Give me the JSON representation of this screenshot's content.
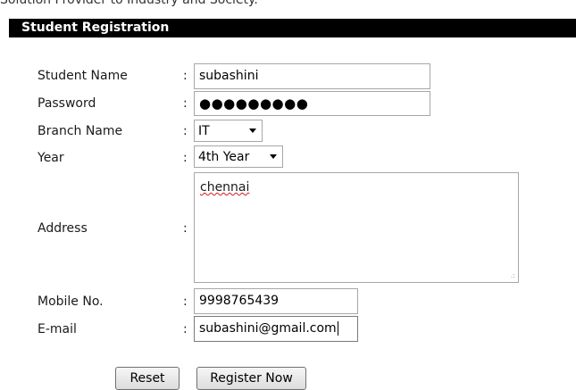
{
  "top_clipped_text": "Solution Provider to Industry and Society.",
  "header": {
    "title": "Student Registration"
  },
  "form": {
    "colon": ":",
    "student_name": {
      "label": "Student Name",
      "value": "subashini"
    },
    "password": {
      "label": "Password",
      "value": "●●●●●●●●●"
    },
    "branch": {
      "label": "Branch Name",
      "selected": "IT"
    },
    "year": {
      "label": "Year",
      "selected": "4th Year"
    },
    "address": {
      "label": "Address",
      "value": "chennai"
    },
    "mobile": {
      "label": "Mobile No.",
      "value": "9998765439"
    },
    "email": {
      "label": "E-mail",
      "value": "subashini@gmail.com"
    }
  },
  "buttons": {
    "reset": "Reset",
    "register": "Register Now"
  }
}
